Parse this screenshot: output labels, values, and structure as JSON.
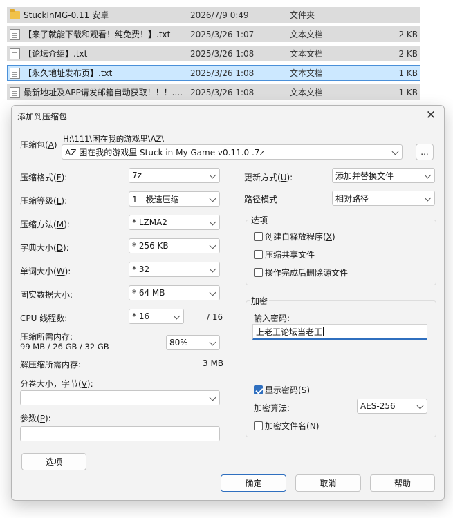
{
  "files": [
    {
      "icon": "folder-icon",
      "name": "StuckInMG-0.11 安卓",
      "date": "2026/7/9 0:49",
      "type": "文件夹",
      "size": ""
    },
    {
      "icon": "text-file-icon",
      "name": "【来了就能下载和观看！纯免费！】.txt",
      "date": "2025/3/26 1:07",
      "type": "文本文档",
      "size": "2 KB"
    },
    {
      "icon": "text-file-icon",
      "name": "【论坛介绍】.txt",
      "date": "2025/3/26 1:08",
      "type": "文本文档",
      "size": "2 KB"
    },
    {
      "icon": "text-file-icon",
      "name": "【永久地址发布页】.txt",
      "date": "2025/3/26 1:08",
      "type": "文本文档",
      "size": "1 KB"
    },
    {
      "icon": "text-file-icon",
      "name": "最新地址及APP请发邮箱自动获取！！！....",
      "date": "2025/3/26 1:08",
      "type": "文本文档",
      "size": "1 KB"
    }
  ],
  "dialog": {
    "title": "添加到压缩包",
    "close": "✕",
    "archive": {
      "label": "压缩包",
      "key": "A",
      "path": "H:\\111\\困在我的游戏里\\AZ\\",
      "name": "AZ 困在我的游戏里 Stuck in My Game  v0.11.0 .7z",
      "browse": "..."
    },
    "left": {
      "format": {
        "label": "压缩格式",
        "key": "F",
        "value": "7z"
      },
      "level": {
        "label": "压缩等级",
        "key": "L",
        "value": "1 - 极速压缩"
      },
      "method": {
        "label": "压缩方法",
        "key": "M",
        "value": "*  LZMA2"
      },
      "dict": {
        "label": "字典大小",
        "key": "D",
        "value": "*  256 KB"
      },
      "word": {
        "label": "单词大小",
        "key": "W",
        "value": "*  32"
      },
      "solid": {
        "label": "固实数据大小:",
        "value": "*  64 MB"
      },
      "threads": {
        "label": "CPU 线程数:",
        "value": "*  16",
        "max": "/ 16"
      },
      "memory": {
        "label": "压缩所需内存:",
        "detail": "99 MB / 26 GB / 32 GB",
        "value": "80%"
      },
      "decomp": {
        "label": "解压缩所需内存:",
        "value": "3 MB"
      },
      "split": {
        "label": "分卷大小，字节",
        "key": "V",
        "value": ""
      },
      "params": {
        "label": "参数",
        "key": "P",
        "value": ""
      },
      "options_button": "选项"
    },
    "right": {
      "update": {
        "label": "更新方式",
        "key": "U",
        "value": "添加并替换文件"
      },
      "path_mode": {
        "label": "路径模式",
        "value": "相对路径"
      },
      "options_group": {
        "title": "选项",
        "sfx": {
          "label": "创建自释放程序",
          "key": "X",
          "checked": false
        },
        "shared": {
          "label": "压缩共享文件",
          "checked": false
        },
        "delete": {
          "label": "操作完成后删除源文件",
          "checked": false
        }
      },
      "encryption": {
        "title": "加密",
        "password_label": "输入密码:",
        "password": "上老王论坛当老王",
        "show_password": {
          "label": "显示密码",
          "key": "S",
          "checked": true
        },
        "method_label": "加密算法:",
        "method": "AES-256",
        "encrypt_names": {
          "label": "加密文件名",
          "key": "N",
          "checked": false
        }
      }
    },
    "buttons": {
      "ok": "确定",
      "cancel": "取消",
      "help": "帮助"
    }
  }
}
